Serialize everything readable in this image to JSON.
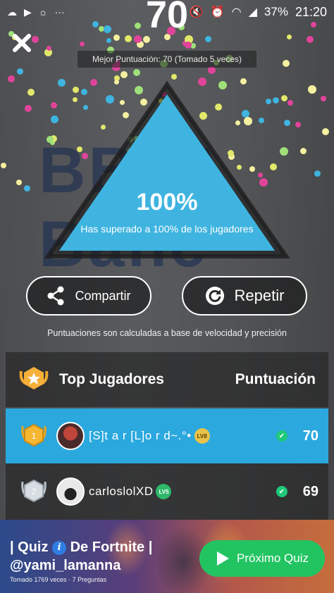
{
  "status_bar": {
    "battery": "37%",
    "time": "21:20"
  },
  "result": {
    "score": "70",
    "best_score_text": "Mejor Puntuación: 70 (Tomado 5 veces)",
    "percent": "100%",
    "percent_text": "Has superado a 100% de los jugadores"
  },
  "actions": {
    "share_label": "Compartir",
    "repeat_label": "Repetir"
  },
  "note": "Puntuaciones son calculadas a base de velocidad y precisión",
  "leaderboard": {
    "title": "Top Jugadores",
    "score_header": "Puntuación",
    "rows": [
      {
        "rank": "1",
        "name": "[S]t a r [L]o r d~.°•",
        "level": "LV8",
        "score": "70"
      },
      {
        "rank": "2",
        "name": "carloslolXD",
        "level": "LV5",
        "score": "69"
      }
    ]
  },
  "quiz": {
    "title_line1_prefix": "| Quiz ",
    "title_line1_suffix": " De Fortnite |",
    "title_line2": "@yami_lamanna",
    "meta_taken": "Tomado 1769 veces",
    "meta_questions": "7 Preguntas",
    "next_label": "Próximo Quiz"
  },
  "colors": {
    "triangle": "#3fb4e0",
    "highlight_row": "#2ba8de",
    "next_button": "#22c462"
  },
  "icons": [
    "close-icon",
    "share-icon",
    "refresh-icon",
    "trophy-icon",
    "gold-medal-icon",
    "silver-medal-icon",
    "check-icon",
    "play-icon",
    "info-icon"
  ]
}
